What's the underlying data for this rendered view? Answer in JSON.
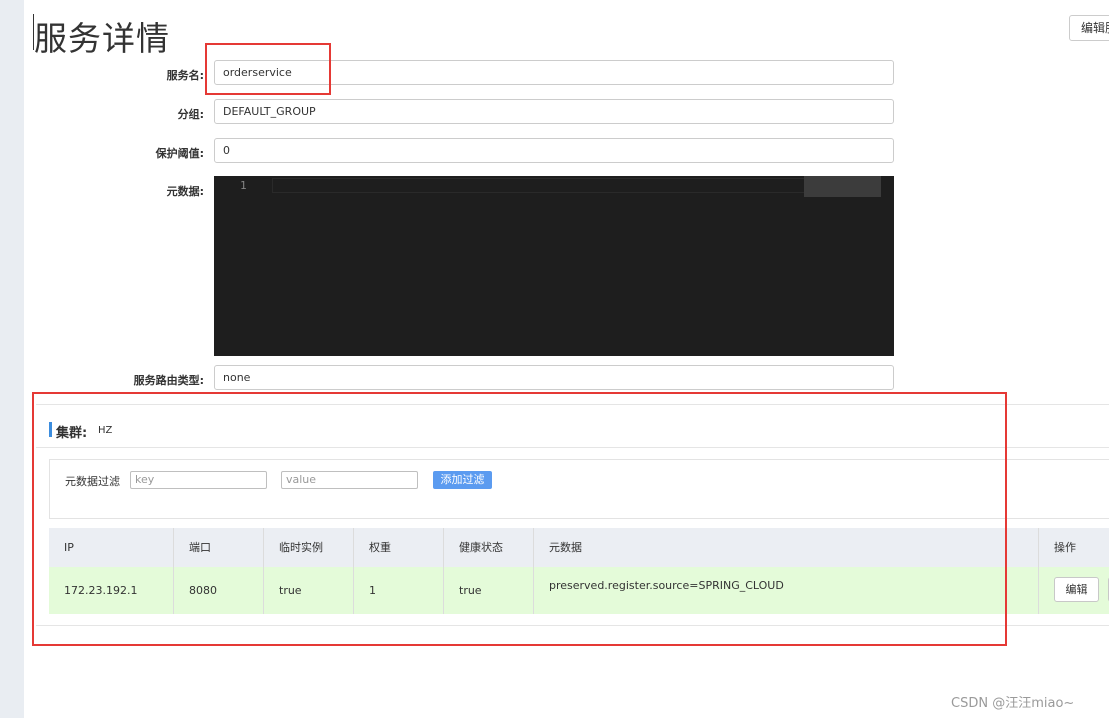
{
  "page": {
    "title": "服务详情",
    "edit_button": "编辑服务"
  },
  "form": {
    "service_name": {
      "label": "服务名:",
      "value": "orderservice"
    },
    "group": {
      "label": "分组:",
      "value": "DEFAULT_GROUP"
    },
    "protect_threshold": {
      "label": "保护阈值:",
      "value": "0"
    },
    "metadata": {
      "label": "元数据:",
      "line_number": "1"
    },
    "route_type": {
      "label": "服务路由类型:",
      "value": "none"
    }
  },
  "cluster": {
    "label": "集群:",
    "name": "HZ",
    "filter": {
      "label": "元数据过滤",
      "key_placeholder": "key",
      "value_placeholder": "value",
      "add_button": "添加过滤"
    },
    "table": {
      "headers": {
        "ip": "IP",
        "port": "端口",
        "ephemeral": "临时实例",
        "weight": "权重",
        "healthy": "健康状态",
        "metadata": "元数据",
        "actions": "操作"
      },
      "rows": [
        {
          "ip": "172.23.192.1",
          "port": "8080",
          "ephemeral": "true",
          "weight": "1",
          "healthy": "true",
          "metadata": "preserved.register.source=SPRING_CLOUD",
          "edit": "编辑"
        }
      ]
    }
  },
  "highlight_color": "#e53935",
  "accent_color": "#3c8dde",
  "watermark": "CSDN @汪汪miao~"
}
